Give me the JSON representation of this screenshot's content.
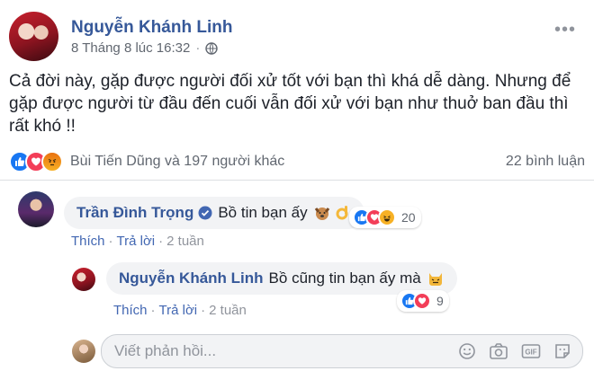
{
  "post": {
    "author": "Nguyễn Khánh Linh",
    "timestamp": "8 Tháng 8 lúc 16:32",
    "text": "Cả đời này, gặp được người đối xử tốt với bạn thì khá dễ dàng. Nhưng để gặp được người từ đầu đến cuối vẫn đối xử với bạn như thuở ban đầu thì rất khó !!",
    "reactions_text": "Bùi Tiến Dũng và 197 người khác",
    "comment_count": "22 bình luận"
  },
  "comments": [
    {
      "author": "Trần Đình Trọng",
      "text": "Bồ tin bạn ấy",
      "like_label": "Thích",
      "reply_label": "Trả lời",
      "time": "2 tuần",
      "reaction_count": "20"
    },
    {
      "author": "Nguyễn Khánh Linh",
      "text": "Bồ cũng tin bạn ấy mà",
      "like_label": "Thích",
      "reply_label": "Trả lời",
      "time": "2 tuần",
      "reaction_count": "9"
    }
  ],
  "reply_box": {
    "placeholder": "Viết phản hồi..."
  },
  "colors": {
    "link_blue": "#365899",
    "action_blue": "#4267b2",
    "like_blue": "#1877f2",
    "love_red": "#f33e58",
    "bubble_gray": "#f2f3f5"
  },
  "icons": [
    "globe-icon",
    "more-icon",
    "like-icon",
    "love-icon",
    "angry-icon",
    "haha-icon",
    "verified-icon",
    "emoji-icon",
    "camera-icon",
    "gif-icon",
    "sticker-icon"
  ]
}
